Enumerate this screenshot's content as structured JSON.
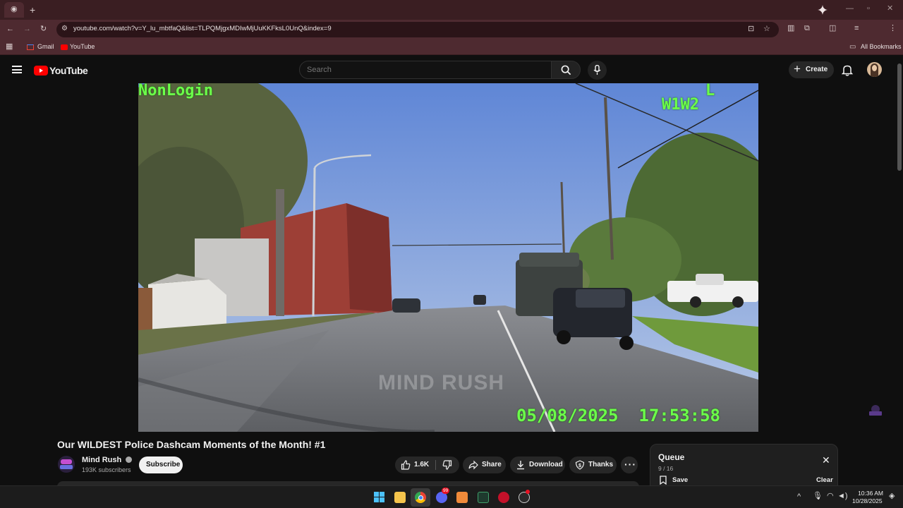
{
  "browser": {
    "url": "youtube.com/watch?v=Y_lu_mbtfaQ&list=TLPQMjgxMDIwMjUuKKFksL0UnQ&index=9",
    "bookmarks": [
      {
        "label": "Gmail",
        "icon": "gmail-icon"
      },
      {
        "label": "YouTube",
        "icon": "youtube-icon"
      }
    ],
    "all_bookmarks_label": "All Bookmarks"
  },
  "youtube": {
    "logo_text": "YouTube",
    "search_placeholder": "Search",
    "create_label": "Create"
  },
  "video": {
    "osd_top_left": "NonLogin",
    "osd_top_right_letter": "L",
    "osd_top_right_code": "W1W2",
    "osd_timestamp": "05/08/2025  17:53:58",
    "watermark": "MIND RUSH"
  },
  "details": {
    "title": "Our WILDEST Police Dashcam Moments of the Month! #1",
    "channel_name": "Mind Rush",
    "subscribers": "193K subscribers",
    "subscribe_label": "Subscribe",
    "like_count": "1.6K",
    "share_label": "Share",
    "download_label": "Download",
    "thanks_label": "Thanks"
  },
  "queue": {
    "title": "Queue",
    "position": "9 / 16",
    "save_label": "Save",
    "clear_label": "Clear"
  },
  "taskbar": {
    "time": "10:36 AM",
    "date": "10/28/2025",
    "discord_badge": "99"
  },
  "colors": {
    "browser_frame": "#4e2a30",
    "youtube_red": "#ff0000",
    "osd_green": "#6cff4a",
    "background": "#0f0f0f"
  }
}
